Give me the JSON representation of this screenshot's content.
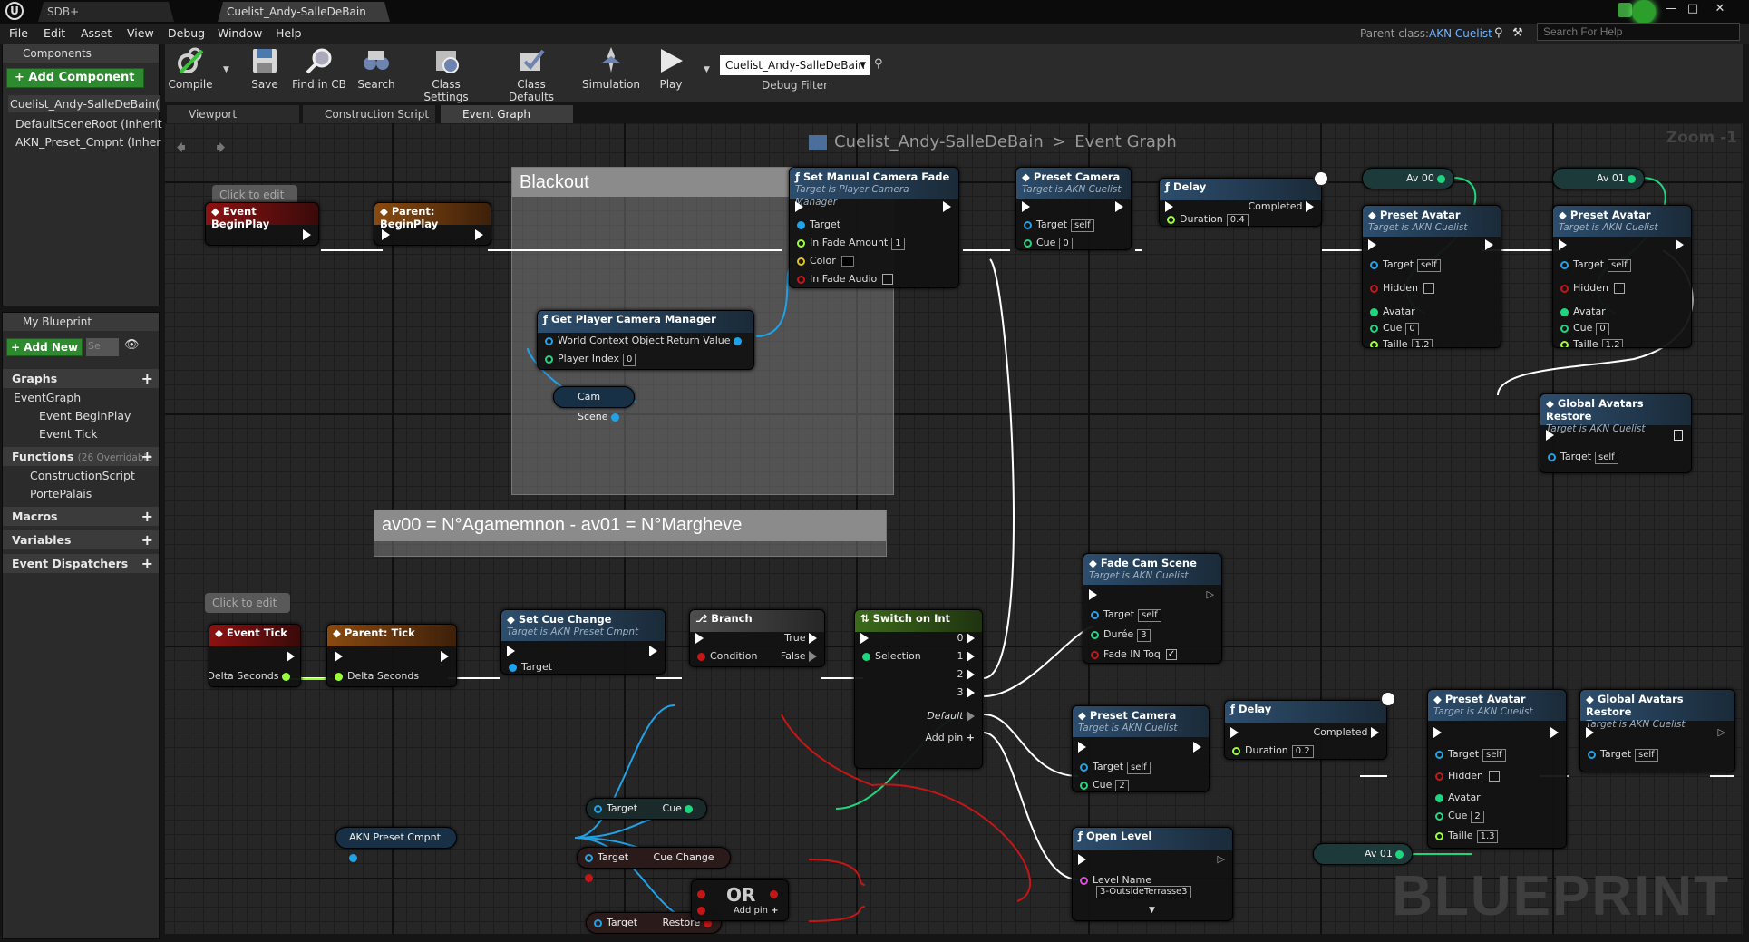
{
  "window": {
    "tabs": [
      "SDB+",
      "Cuelist_Andy-SalleDeBain"
    ],
    "controls": [
      "—",
      "□",
      "✕"
    ]
  },
  "menu": {
    "items": [
      "File",
      "Edit",
      "Asset",
      "View",
      "Debug",
      "Window",
      "Help"
    ],
    "parent_class_label": "Parent class:",
    "parent_class_value": "AKN Cuelist",
    "search_help_placeholder": "Search For Help"
  },
  "components_panel": {
    "tab": "Components",
    "add_button": "+ Add Component",
    "items": [
      "Cuelist_Andy-SalleDeBain(",
      "DefaultSceneRoot (Inherit",
      "AKN_Preset_Cmpnt (Inher"
    ]
  },
  "my_blueprint": {
    "tab": "My Blueprint",
    "add_new": "+ Add New",
    "search_placeholder": "Se",
    "graphs_header": "Graphs",
    "graphs": [
      "EventGraph",
      "Event BeginPlay",
      "Event Tick"
    ],
    "functions_header": "Functions",
    "functions_overridable": "(26 Overridable",
    "functions": [
      "ConstructionScript",
      "PortePalais"
    ],
    "macros_header": "Macros",
    "variables_header": "Variables",
    "dispatchers_header": "Event Dispatchers"
  },
  "toolbar": {
    "compile": "Compile",
    "save": "Save",
    "find_in_cb": "Find in CB",
    "search": "Search",
    "class_settings": "Class Settings",
    "class_defaults": "Class Defaults",
    "simulation": "Simulation",
    "play": "Play",
    "debug_object": "Cuelist_Andy-SalleDeBain",
    "debug_filter": "Debug Filter"
  },
  "graph_tabs": [
    "Viewport",
    "Construction Script",
    "Event Graph"
  ],
  "graph": {
    "breadcrumb_root": "Cuelist_Andy-SalleDeBain",
    "breadcrumb_sep": ">",
    "breadcrumb_leaf": "Event Graph",
    "zoom": "Zoom -1",
    "watermark": "BLUEPRINT",
    "click_to_edit": "Click to edit",
    "comment_blackout": "Blackout",
    "comment_avatars": "av00 = N°Agamemnon - av01 = N°Margheve"
  },
  "nodes": {
    "event_beginplay": "Event BeginPlay",
    "parent_beginplay": "Parent: BeginPlay",
    "get_player_camera_manager": "Get Player Camera Manager",
    "world_context_object": "World Context Object",
    "return_value": "Return Value",
    "player_index": "Player Index",
    "player_index_val": "0",
    "cam_scene": "Cam Scene",
    "set_manual_camera_fade": "Set Manual Camera Fade",
    "target_is_player_camera_manager": "Target is Player Camera Manager",
    "target": "Target",
    "in_fade_amount": "In Fade Amount",
    "in_fade_amount_val": "1",
    "color": "Color",
    "in_fade_audio": "In Fade Audio",
    "preset_camera": "Preset Camera",
    "target_is_akn_cuelist": "Target is AKN Cuelist",
    "self": "self",
    "cue": "Cue",
    "cue_0": "0",
    "delay": "Delay",
    "completed": "Completed",
    "duration": "Duration",
    "duration_04": "0.4",
    "av00": "Av 00",
    "av01": "Av 01",
    "preset_avatar": "Preset Avatar",
    "hidden": "Hidden",
    "avatar": "Avatar",
    "taille": "Taille",
    "taille_12": "1.2",
    "global_avatars_restore": "Global Avatars Restore",
    "event_tick": "Event Tick",
    "delta_seconds": "Delta Seconds",
    "parent_tick": "Parent: Tick",
    "set_cue_change": "Set Cue Change",
    "target_is_akn_preset_cmpnt": "Target is AKN Preset Cmpnt",
    "branch": "Branch",
    "true": "True",
    "false": "False",
    "condition": "Condition",
    "switch_on_int": "Switch on Int",
    "selection": "Selection",
    "default": "Default",
    "add_pin": "Add pin",
    "switch_outs": [
      "0",
      "1",
      "2",
      "3"
    ],
    "fade_cam_scene": "Fade Cam Scene",
    "duree": "Durée",
    "duree_val": "3",
    "fade_in_toq": "Fade IN Toq",
    "cue_2": "2",
    "duration_02": "0.2",
    "taille_13": "1.3",
    "open_level": "Open Level",
    "level_name": "Level Name",
    "level_name_val": "3-OutsideTerrasse3",
    "akn_preset_cmpnt": "AKN Preset Cmpnt",
    "cue_change": "Cue Change",
    "restore": "Restore",
    "or": "OR"
  },
  "colors": {
    "event_header": "#8c1212",
    "function_header": "#2d4e6e",
    "object_pin": "#1fa2e8",
    "float_pin": "#9aff3a",
    "bool_pin": "#c41616",
    "int_pin": "#1ed67e"
  }
}
